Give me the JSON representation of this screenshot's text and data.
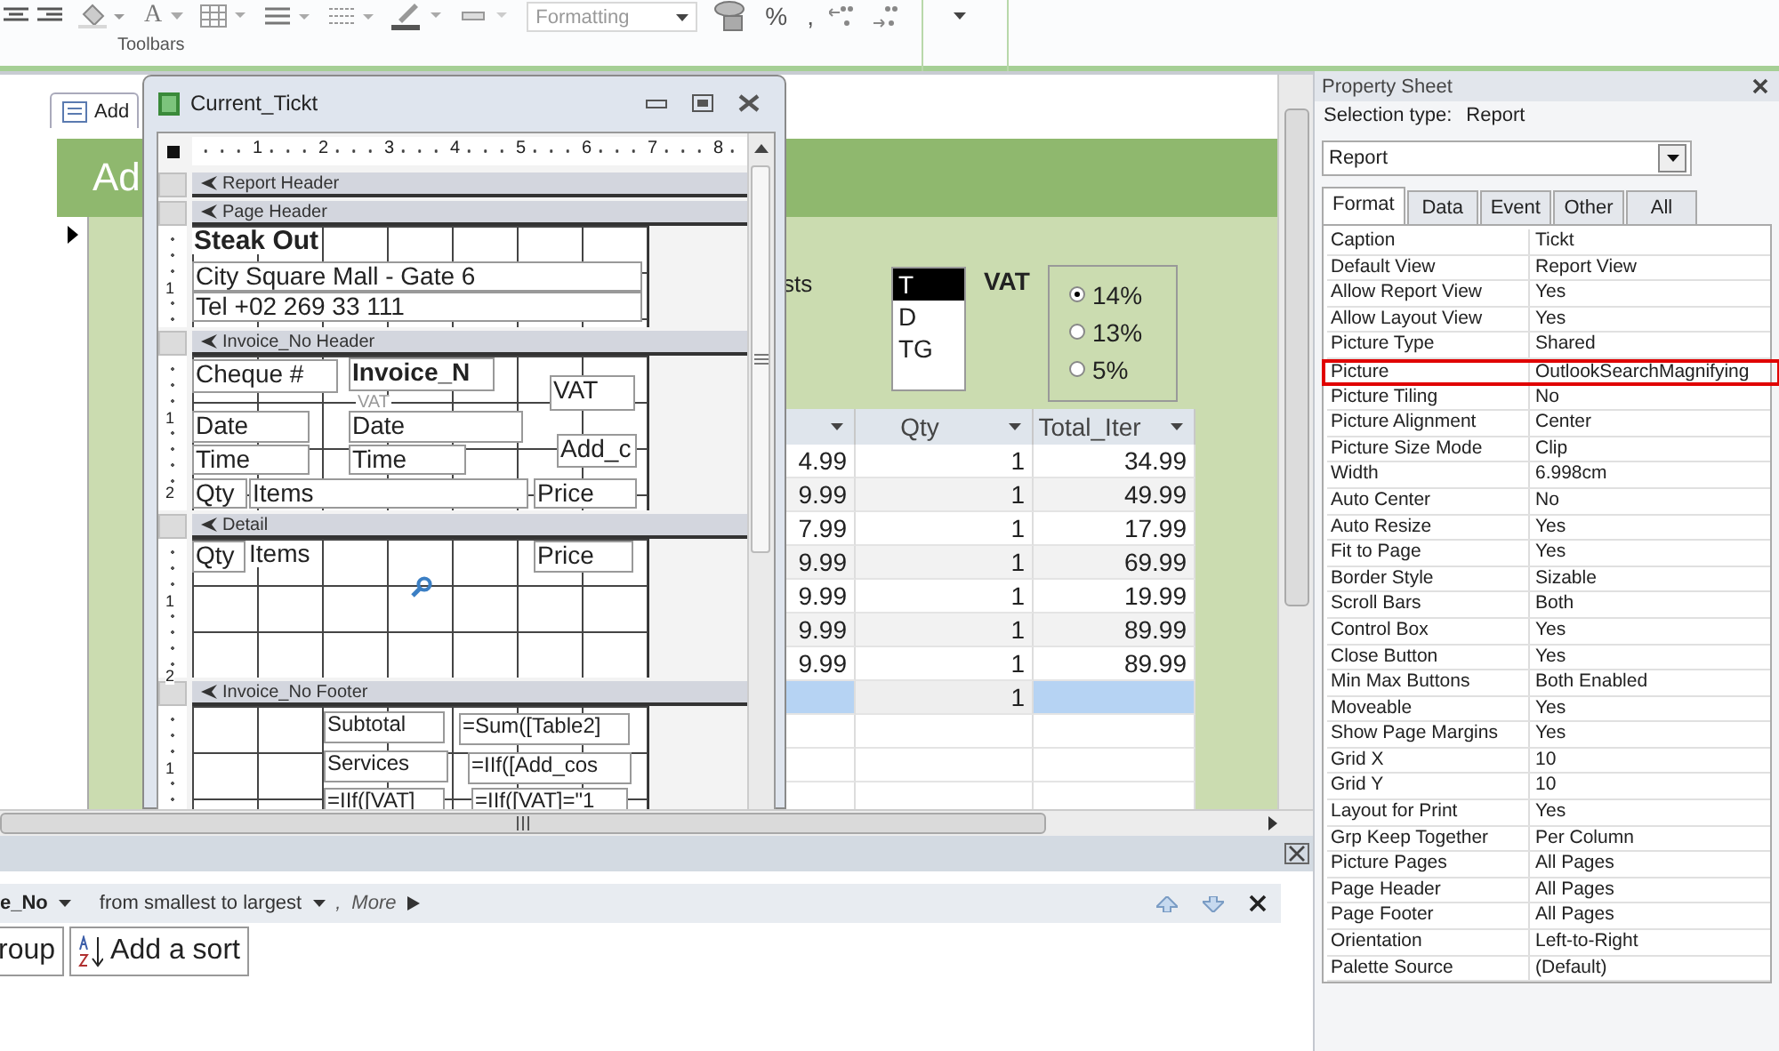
{
  "ribbon": {
    "font_color_button": "A",
    "format_dropdown": {
      "value": "Formatting",
      "disabled": true
    },
    "percent_button": "%",
    "comma_button": ",",
    "group_label": "Toolbars"
  },
  "form_window": {
    "tab": "Add",
    "header_title": "Ad",
    "costs_label": "sts",
    "list_box": [
      {
        "label": "T",
        "selected": true
      },
      {
        "label": "D",
        "selected": false
      },
      {
        "label": "TG",
        "selected": false
      }
    ],
    "vat_label": "VAT",
    "vat_options": [
      {
        "label": "14%",
        "selected": true
      },
      {
        "label": "13%",
        "selected": false
      },
      {
        "label": "5%",
        "selected": false
      }
    ],
    "table": {
      "columns": [
        "Qty",
        "Total_Iter"
      ],
      "rows": [
        {
          "column_1": "4.99",
          "qty": "1",
          "total": "34.99",
          "selected": false
        },
        {
          "column_1": "9.99",
          "qty": "1",
          "total": "49.99",
          "selected": false
        },
        {
          "column_1": "7.99",
          "qty": "1",
          "total": "17.99",
          "selected": false
        },
        {
          "column_1": "9.99",
          "qty": "1",
          "total": "69.99",
          "selected": false
        },
        {
          "column_1": "9.99",
          "qty": "1",
          "total": "19.99",
          "selected": false
        },
        {
          "column_1": "9.99",
          "qty": "1",
          "total": "89.99",
          "selected": false
        },
        {
          "column_1": "9.99",
          "qty": "1",
          "total": "89.99",
          "selected": false
        },
        {
          "qty": "1",
          "selected": true
        }
      ]
    }
  },
  "design_window": {
    "title": "Current_Tickt",
    "ruler": [
      "1",
      "2",
      "3",
      "4",
      "5",
      "6",
      "7",
      "8"
    ],
    "sections": [
      {
        "title": "Report Header"
      },
      {
        "title": "Page Header",
        "ruler_marks": [
          "1"
        ],
        "controls": [
          {
            "text": "Steak Out",
            "kind": "plain",
            "bold": true
          },
          {
            "text": "City Square Mall - Gate 6",
            "kind": "label",
            "bold": false
          },
          {
            "text": "Tel +02 269 33 111",
            "kind": "label",
            "bold": false
          }
        ]
      },
      {
        "title": "Invoice_No Header",
        "ruler_marks": [
          "1",
          "2"
        ],
        "controls": [
          {
            "text": "Cheque #",
            "kind": "label",
            "bold": false
          },
          {
            "text": "Invoice_N",
            "kind": "label",
            "bold": true
          },
          {
            "text": "VAT",
            "kind": "ghost",
            "bold": false
          },
          {
            "text": "VAT",
            "kind": "label",
            "bold": false
          },
          {
            "text": "Date",
            "kind": "label",
            "bold": false
          },
          {
            "text": "Date",
            "kind": "label",
            "bold": false
          },
          {
            "text": "Time",
            "kind": "label",
            "bold": false
          },
          {
            "text": "Time",
            "kind": "label",
            "bold": false
          },
          {
            "text": "Add_c",
            "kind": "label",
            "bold": false
          },
          {
            "text": "Qty",
            "kind": "label",
            "bold": false
          },
          {
            "text": "Items",
            "kind": "label",
            "bold": false
          },
          {
            "text": "Price",
            "kind": "label",
            "bold": false
          }
        ]
      },
      {
        "title": "Detail",
        "ruler_marks": [
          "1",
          "2"
        ],
        "controls": [
          {
            "text": "Qty",
            "kind": "label",
            "bold": false
          },
          {
            "text": "Items",
            "kind": "plain",
            "bold": false
          },
          {
            "text": "Price",
            "kind": "label",
            "bold": false
          }
        ]
      },
      {
        "title": "Invoice_No Footer",
        "ruler_marks": [
          "1"
        ],
        "controls": [
          {
            "text": "Subtotal",
            "kind": "label",
            "bold": false
          },
          {
            "text": "=Sum([Table2]",
            "kind": "label",
            "bold": false
          },
          {
            "text": "Services",
            "kind": "label",
            "bold": false
          },
          {
            "text": "=IIf([Add_cos",
            "kind": "label",
            "bold": false
          },
          {
            "text": "=IIf([VAT]",
            "kind": "label",
            "bold": false
          },
          {
            "text": "=IIf([VAT]=\"1",
            "kind": "label",
            "bold": false
          }
        ]
      }
    ]
  },
  "sort_pane": {
    "field": "e_No",
    "order": "from smallest to largest",
    "separator": ",",
    "more": "More",
    "buttons": [
      {
        "label": "roup",
        "kind": "group"
      },
      {
        "label": "Add a sort",
        "kind": "sort"
      }
    ]
  },
  "property_sheet": {
    "title": "Property Sheet",
    "selection_type_label": "Selection type:",
    "selection_type": "Report",
    "object_dropdown": "Report",
    "tabs": [
      {
        "label": "Format",
        "selected": true
      },
      {
        "label": "Data",
        "selected": false
      },
      {
        "label": "Event",
        "selected": false
      },
      {
        "label": "Other",
        "selected": false
      },
      {
        "label": "All",
        "selected": false
      }
    ],
    "properties": [
      {
        "name": "Caption",
        "value": "Tickt",
        "highlighted": false
      },
      {
        "name": "Default View",
        "value": "Report View",
        "highlighted": false
      },
      {
        "name": "Allow Report View",
        "value": "Yes",
        "highlighted": false
      },
      {
        "name": "Allow Layout View",
        "value": "Yes",
        "highlighted": false
      },
      {
        "name": "Picture Type",
        "value": "Shared",
        "highlighted": false
      },
      {
        "name": "Picture",
        "value": "OutlookSearchMagnifying",
        "highlighted": true
      },
      {
        "name": "Picture Tiling",
        "value": "No",
        "highlighted": false
      },
      {
        "name": "Picture Alignment",
        "value": "Center",
        "highlighted": false
      },
      {
        "name": "Picture Size Mode",
        "value": "Clip",
        "highlighted": false
      },
      {
        "name": "Width",
        "value": "6.998cm",
        "highlighted": false
      },
      {
        "name": "Auto Center",
        "value": "No",
        "highlighted": false
      },
      {
        "name": "Auto Resize",
        "value": "Yes",
        "highlighted": false
      },
      {
        "name": "Fit to Page",
        "value": "Yes",
        "highlighted": false
      },
      {
        "name": "Border Style",
        "value": "Sizable",
        "highlighted": false
      },
      {
        "name": "Scroll Bars",
        "value": "Both",
        "highlighted": false
      },
      {
        "name": "Control Box",
        "value": "Yes",
        "highlighted": false
      },
      {
        "name": "Close Button",
        "value": "Yes",
        "highlighted": false
      },
      {
        "name": "Min Max Buttons",
        "value": "Both Enabled",
        "highlighted": false
      },
      {
        "name": "Moveable",
        "value": "Yes",
        "highlighted": false
      },
      {
        "name": "Show Page Margins",
        "value": "Yes",
        "highlighted": false
      },
      {
        "name": "Grid X",
        "value": "10",
        "highlighted": false
      },
      {
        "name": "Grid Y",
        "value": "10",
        "highlighted": false
      },
      {
        "name": "Layout for Print",
        "value": "Yes",
        "highlighted": false
      },
      {
        "name": "Grp Keep Together",
        "value": "Per Column",
        "highlighted": false
      },
      {
        "name": "Picture Pages",
        "value": "All Pages",
        "highlighted": false
      },
      {
        "name": "Page Header",
        "value": "All Pages",
        "highlighted": false
      },
      {
        "name": "Page Footer",
        "value": "All Pages",
        "highlighted": false
      },
      {
        "name": "Orientation",
        "value": "Left-to-Right",
        "highlighted": false
      },
      {
        "name": "Palette Source",
        "value": "(Default)",
        "highlighted": false
      }
    ]
  }
}
